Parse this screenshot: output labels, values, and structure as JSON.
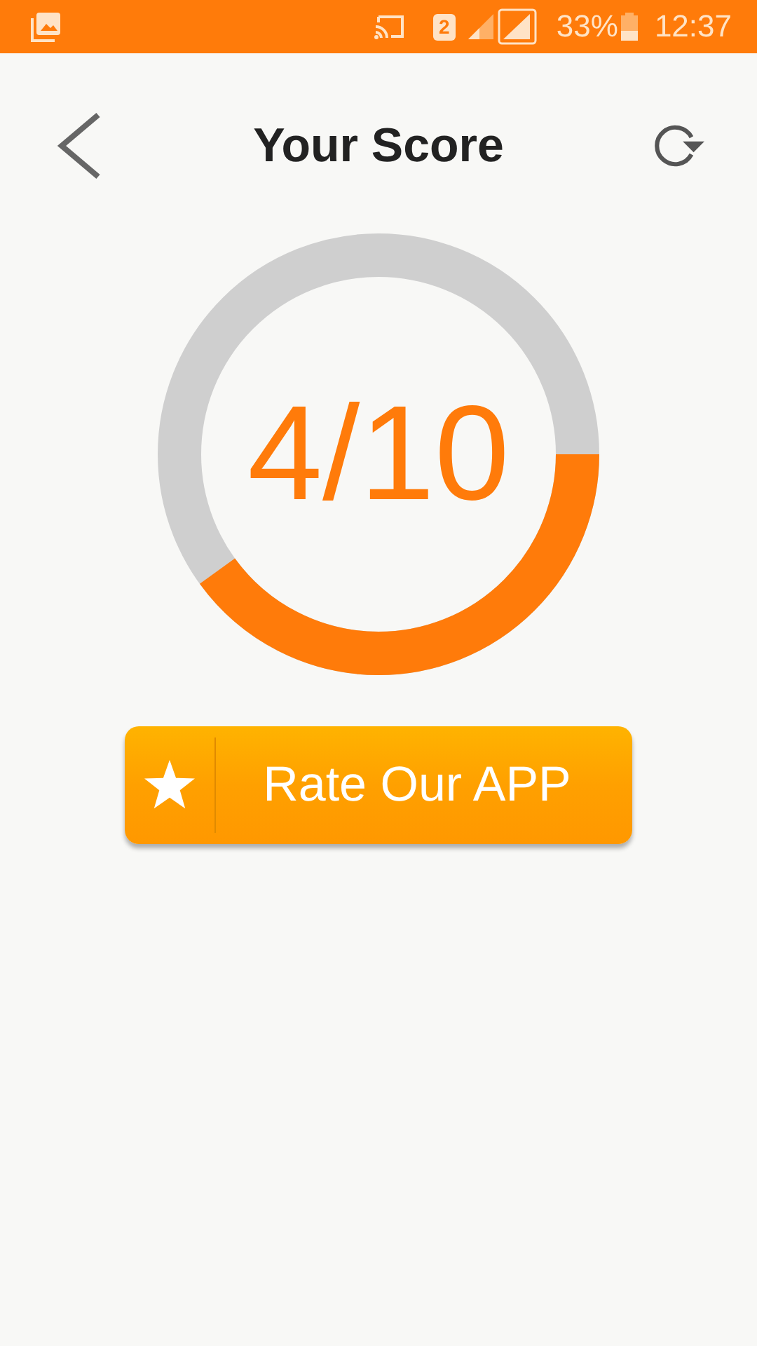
{
  "status_bar": {
    "sim_slot": "2",
    "battery": "33%",
    "time": "12:37"
  },
  "header": {
    "title": "Your Score"
  },
  "score": {
    "text": "4/10",
    "level": 0.4
  },
  "rate_button": {
    "label": "Rate Our APP"
  }
}
